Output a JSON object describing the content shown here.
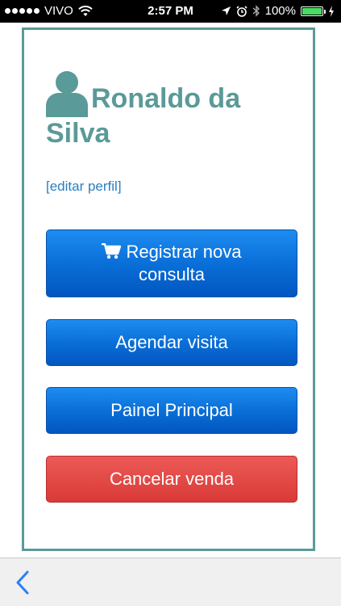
{
  "status_bar": {
    "carrier": "VIVO",
    "time": "2:57 PM",
    "battery": "100%",
    "icons": [
      "signal-dots",
      "wifi-icon",
      "location-arrow-icon",
      "alarm-icon",
      "bluetooth-icon",
      "battery-icon",
      "charging-icon"
    ]
  },
  "profile": {
    "name": "Ronaldo da Silva",
    "edit_link": "[editar perfil]",
    "icon": "user-icon"
  },
  "buttons": {
    "register_line1": "Registrar nova",
    "register_line2": "consulta",
    "schedule": "Agendar visita",
    "main_panel": "Painel Principal",
    "cancel_sale": "Cancelar venda"
  },
  "colors": {
    "accent": "#5a9a98",
    "link": "#2a7fbf",
    "primary": "#0a6fd8",
    "danger": "#d93a36"
  },
  "navigation": {
    "back_icon": "chevron-left-icon"
  }
}
